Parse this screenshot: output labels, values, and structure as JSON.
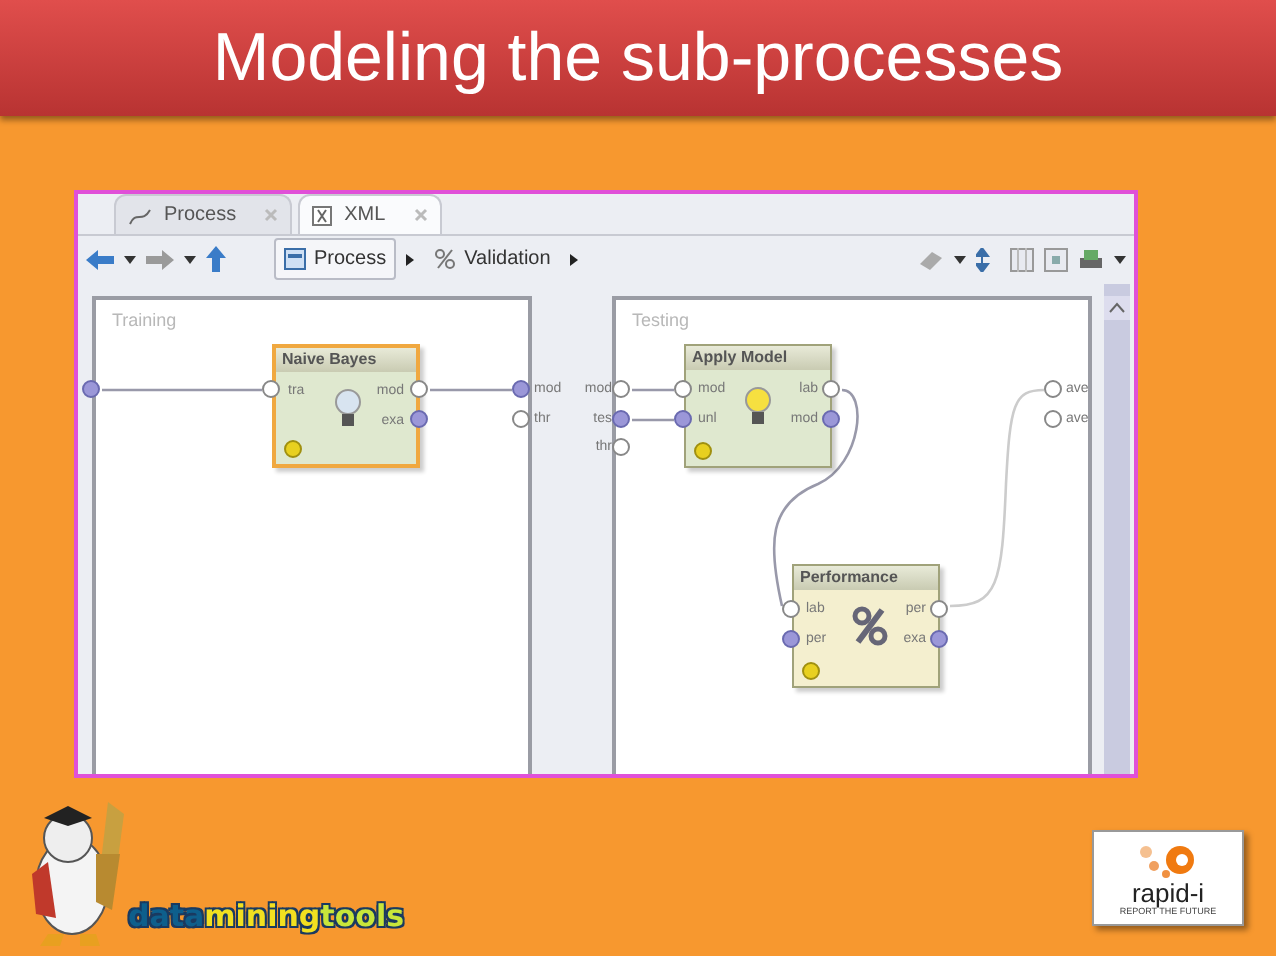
{
  "slide_title": "Modeling the sub-processes",
  "tabs": [
    {
      "label": "Process",
      "selected": false
    },
    {
      "label": "XML",
      "selected": true
    }
  ],
  "breadcrumb": [
    {
      "label": "Process",
      "selected": true
    },
    {
      "label": "Validation",
      "selected": false
    }
  ],
  "panels": [
    {
      "label": "Training",
      "ports_right": [
        "mod",
        "thr"
      ]
    },
    {
      "label": "Testing",
      "ports_left": [
        "mod",
        "tes",
        "thr"
      ],
      "ports_right": [
        "ave",
        "ave"
      ]
    }
  ],
  "operators": [
    {
      "name": "Naive Bayes",
      "selected": true,
      "kind": "bulb",
      "color": "#dfe8cf",
      "inputs": [
        "tra"
      ],
      "outputs": [
        "mod",
        "exa"
      ]
    },
    {
      "name": "Apply Model",
      "selected": false,
      "kind": "bulb",
      "color": "#dfe8cf",
      "inputs": [
        "mod",
        "unl"
      ],
      "outputs": [
        "lab",
        "mod"
      ]
    },
    {
      "name": "Performance",
      "selected": false,
      "kind": "percent",
      "color": "#f4efcf",
      "inputs": [
        "lab",
        "per"
      ],
      "outputs": [
        "per",
        "exa"
      ]
    }
  ],
  "logo_words": [
    {
      "text": "data",
      "color": "#0e5f8c"
    },
    {
      "text": "mining",
      "color": "#f2e020"
    },
    {
      "text": "tools",
      "color": "#c8e63a"
    }
  ],
  "brand": {
    "name": "rapid-i",
    "tagline": "REPORT THE FUTURE"
  }
}
